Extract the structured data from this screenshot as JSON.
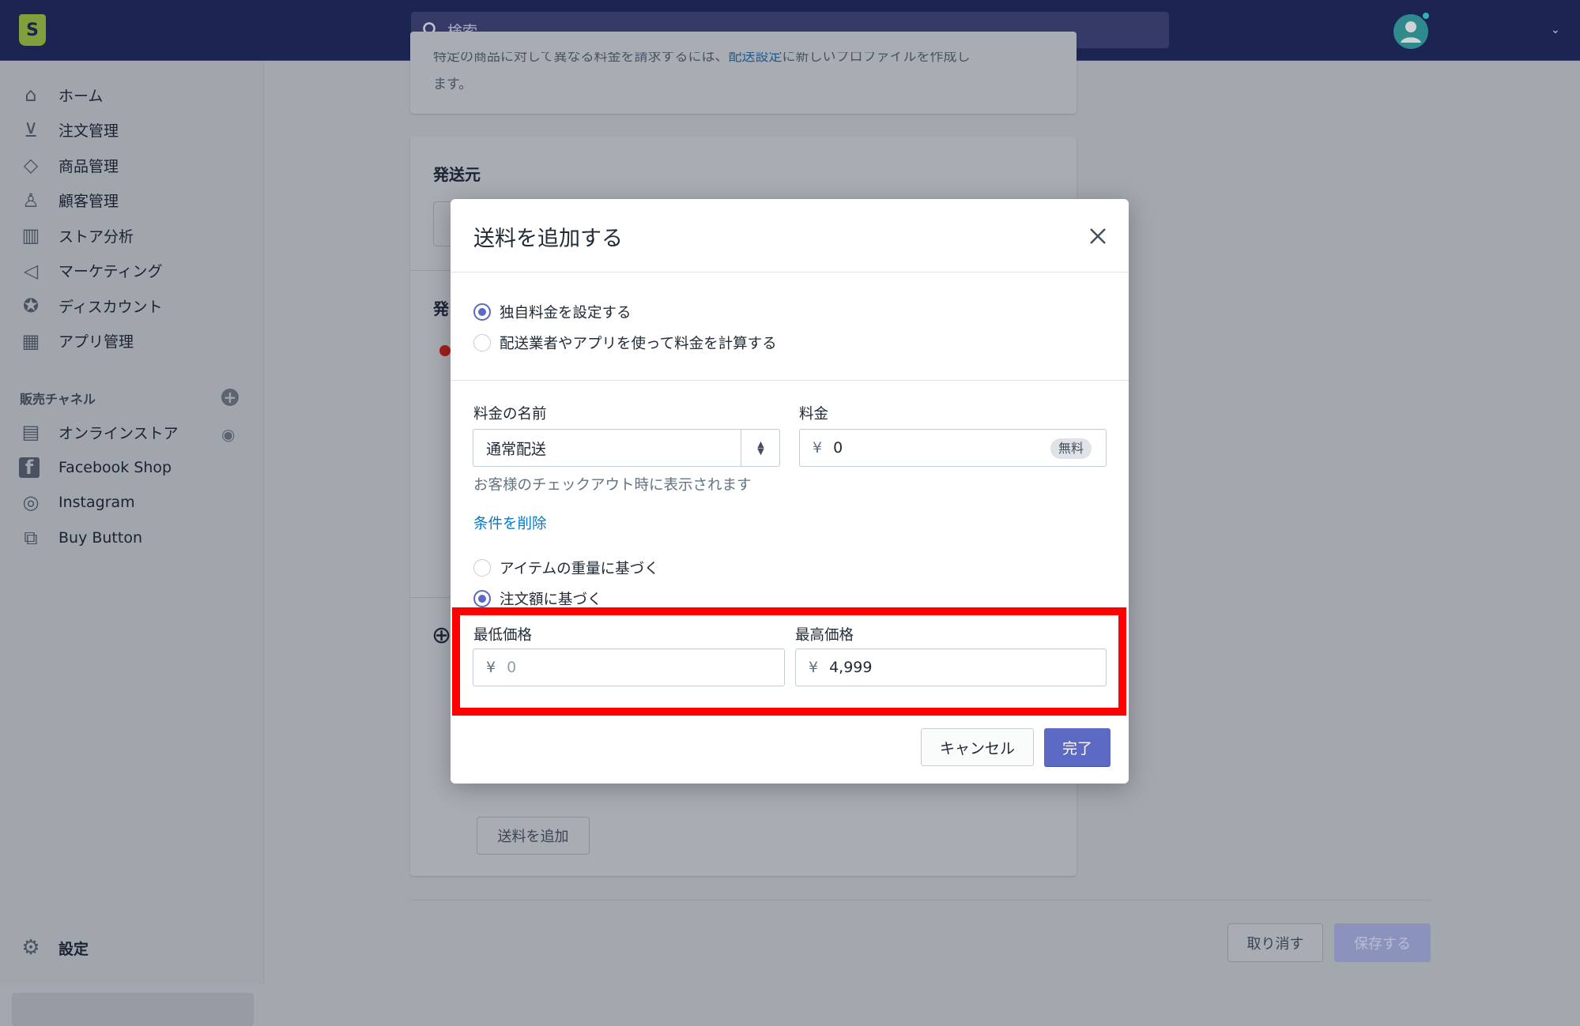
{
  "topbar": {
    "search_placeholder": "検索",
    "logo": "S"
  },
  "sidebar": {
    "items": [
      {
        "label": "ホーム",
        "icon": "home-icon"
      },
      {
        "label": "注文管理",
        "icon": "orders-icon"
      },
      {
        "label": "商品管理",
        "icon": "tag-icon"
      },
      {
        "label": "顧客管理",
        "icon": "person-icon"
      },
      {
        "label": "ストア分析",
        "icon": "bar-chart-icon"
      },
      {
        "label": "マーケティング",
        "icon": "megaphone-icon"
      },
      {
        "label": "ディスカウント",
        "icon": "discount-icon"
      },
      {
        "label": "アプリ管理",
        "icon": "apps-icon"
      }
    ],
    "channels_title": "販売チャネル",
    "channels": [
      {
        "label": "オンラインストア",
        "icon": "store-icon"
      },
      {
        "label": "Facebook Shop",
        "icon": "facebook-icon"
      },
      {
        "label": "Instagram",
        "icon": "instagram-icon"
      },
      {
        "label": "Buy Button",
        "icon": "buy-button-icon"
      }
    ],
    "settings": "設定"
  },
  "background": {
    "note_part1": "特定の商品に対して異なる料金を請求するには、",
    "note_link": "配送設定",
    "note_part2": "に新しいプロファイルを作成し",
    "note_end": "ます。",
    "origin_title": "発送元",
    "section_char": "発",
    "add_rate_button": "送料を追加",
    "discard_button": "取り消す",
    "save_button": "保存する"
  },
  "modal": {
    "title": "送料を追加する",
    "rate_type_options": [
      {
        "label": "独自料金を設定する",
        "selected": true
      },
      {
        "label": "配送業者やアプリを使って料金を計算する",
        "selected": false
      }
    ],
    "rate_name_label": "料金の名前",
    "rate_name_value": "通常配送",
    "rate_name_help": "お客様のチェックアウト時に表示されます",
    "price_label": "料金",
    "currency": "¥",
    "price_value": "0",
    "free_badge": "無料",
    "remove_conditions_link": "条件を削除",
    "condition_options": [
      {
        "label": "アイテムの重量に基づく",
        "selected": false
      },
      {
        "label": "注文額に基づく",
        "selected": true
      }
    ],
    "min_price_label": "最低価格",
    "min_price_placeholder": "0",
    "max_price_label": "最高価格",
    "max_price_value": "4,999",
    "cancel_button": "キャンセル",
    "done_button": "完了"
  },
  "colors": {
    "primary": "#5c6ac4",
    "link": "#007ace",
    "highlight": "#ff0000",
    "topbar": "#1c2452"
  }
}
